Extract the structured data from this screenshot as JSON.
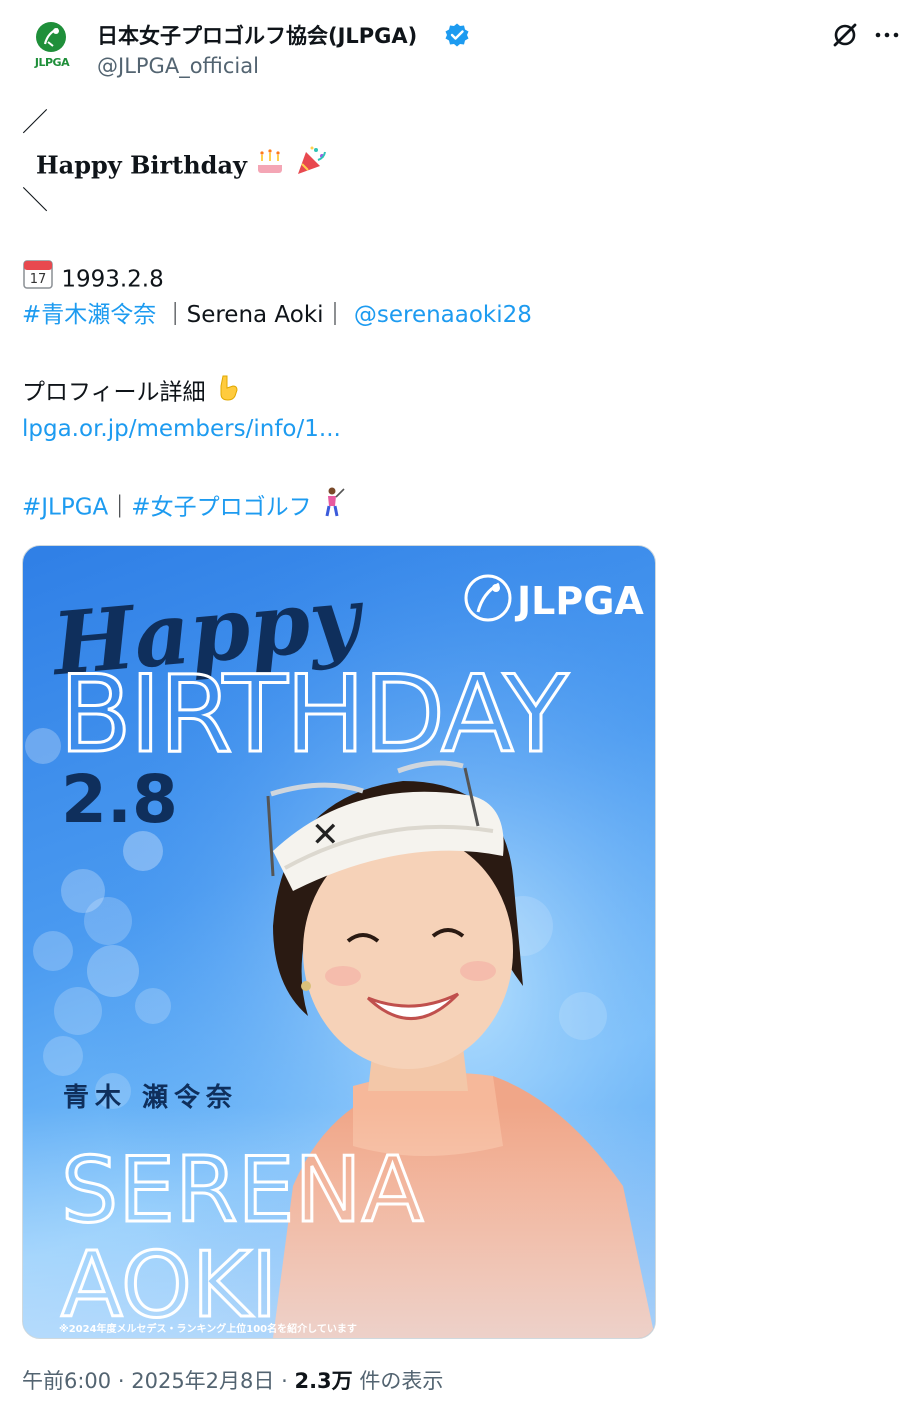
{
  "header": {
    "display_name": "日本女子プロゴルフ協会(JLPGA)",
    "handle": "@JLPGA_official",
    "avatar_text": "JLPGA",
    "icons": [
      "verified-badge-icon",
      "grok-icon",
      "more-options-icon"
    ]
  },
  "tweet": {
    "line_slash_open": "／",
    "line_title": "Happy Birthday",
    "line_slash_close": "＼",
    "birthdate": "1993.2.8",
    "hashtag_name": "#青木瀬令奈",
    "separator_1": "｜",
    "name_en": "Serena Aoki",
    "separator_2": "｜",
    "mention": "@serenaaoki28",
    "profile_label": "プロフィール詳細",
    "profile_link": "lpga.or.jp/members/info/1...",
    "hashtag_jlpga": "#JLPGA",
    "separator_3": "｜",
    "hashtag_golf": "#女子プロゴルフ",
    "emojis": [
      "birthday-cake-icon",
      "party-popper-icon",
      "calendar-icon",
      "pointing-down-icon",
      "golfer-icon"
    ]
  },
  "media": {
    "script_text": "Happy",
    "birthday_text": "BIRTHDAY",
    "date_text": "2.8",
    "logo_text": "JLPGA",
    "name_jp": "青木 瀬令奈",
    "name_en_line1": "SERENA",
    "name_en_line2": "AOKI",
    "footnote": "※2024年度メルセデス・ランキング上位100名を紹介しています"
  },
  "footer": {
    "time": "午前6:00",
    "dot_1": "·",
    "date": "2025年2月8日",
    "dot_2": "·",
    "views_count": "2.3万",
    "views_label": "件の表示"
  },
  "colors": {
    "link": "#1d9bf0",
    "secondary_text": "#536471",
    "primary_text": "#0f1419",
    "brand_green": "#1f8f3a",
    "media_blue": "#3d8ff0",
    "verified_blue": "#1d9bf0"
  }
}
